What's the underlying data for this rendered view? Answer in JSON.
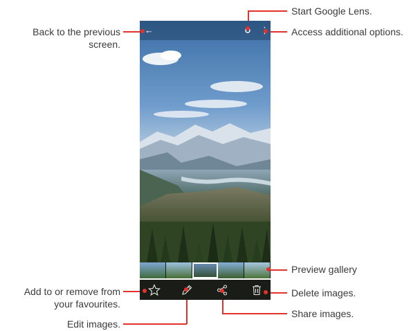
{
  "labels": {
    "back": [
      "Back to the previous",
      "screen."
    ],
    "lens": "Start Google Lens.",
    "options": "Access additional options.",
    "preview": "Preview gallery",
    "favourite": [
      "Add to or remove from",
      "your favourites."
    ],
    "delete": "Delete images.",
    "share": "Share images.",
    "edit": "Edit images."
  },
  "icons": {
    "back": "arrow-left",
    "lens": "google-lens",
    "options": "more-vertical",
    "favourite": "star",
    "edit": "pencil",
    "share": "share",
    "delete": "trash"
  },
  "colors": {
    "callout": "#e4322b",
    "label": "#3a3a3a"
  }
}
